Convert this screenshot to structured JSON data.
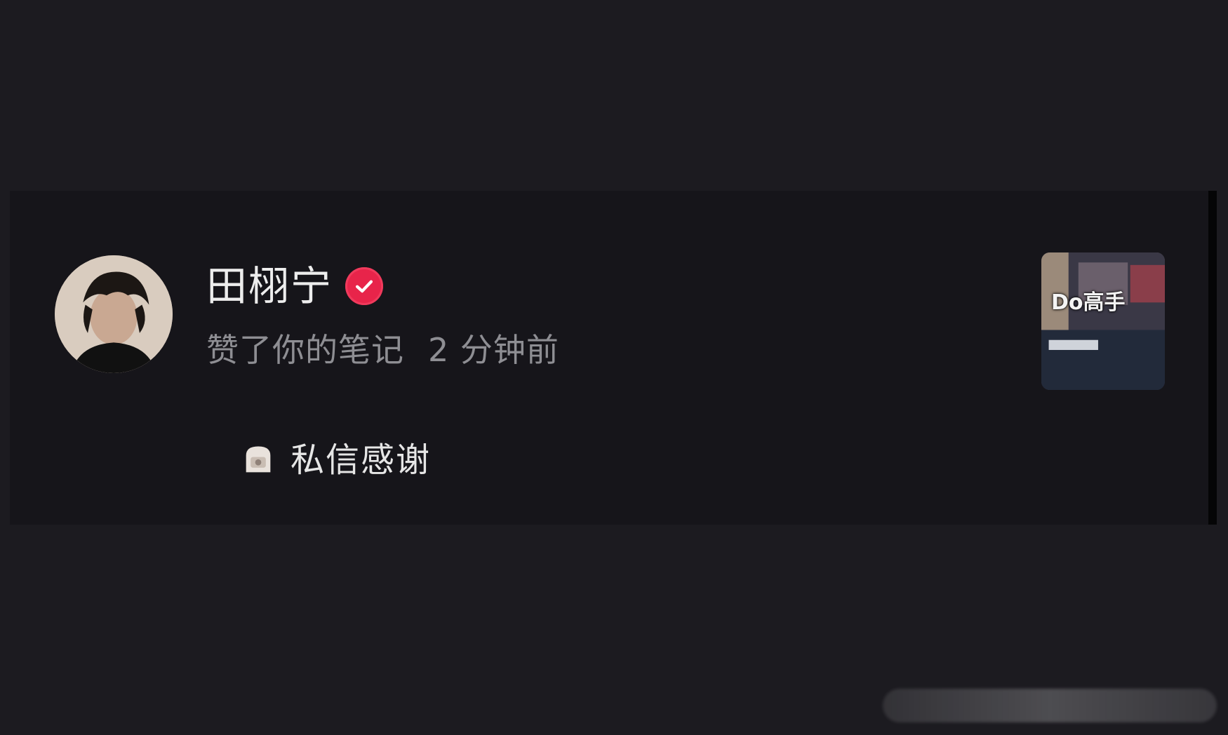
{
  "notification": {
    "user_name": "田栩宁",
    "action_text": "赞了你的笔记",
    "time_text": "2 分钟前",
    "note_thumbnail_caption": "Do高手",
    "reply_button_label": "私信感谢",
    "verified_color": "#e8244a",
    "icons": {
      "avatar": "user-avatar",
      "verified": "verified-check-icon",
      "reply": "sticker-icon"
    }
  }
}
